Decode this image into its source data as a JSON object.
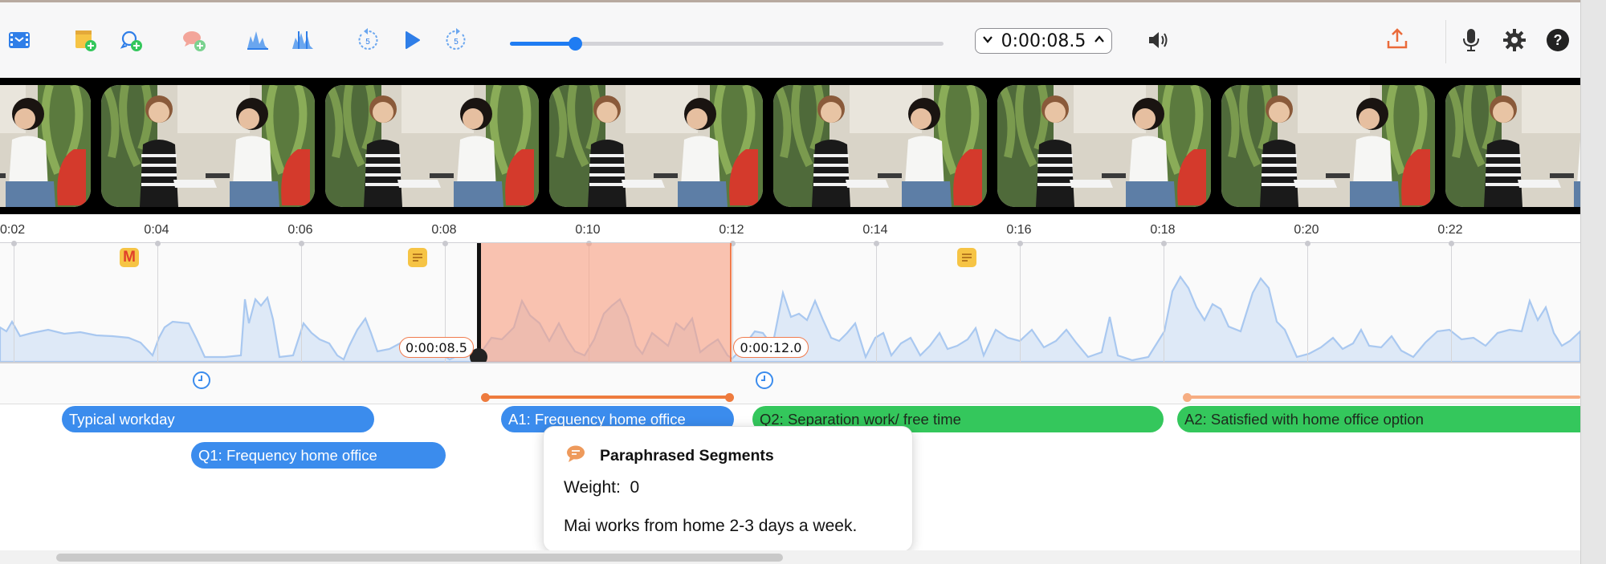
{
  "toolbar": {
    "icons": [
      "film-strip-icon",
      "add-document-icon",
      "add-memo-icon",
      "add-comment-icon",
      "waveform-icon",
      "waveform-edit-icon",
      "rewind-5-icon",
      "play-icon",
      "forward-5-icon",
      "volume-icon",
      "export-icon",
      "microphone-icon",
      "settings-icon",
      "help-icon"
    ],
    "accent_color": "#1f7cf2",
    "playback_position": 0.15,
    "time_value": "0:00:08.5"
  },
  "filmstrip": {
    "frame_count": 8
  },
  "ruler": {
    "ticks": [
      "0:02",
      "0:04",
      "0:06",
      "0:08",
      "0:10",
      "0:12",
      "0:14",
      "0:16",
      "0:18",
      "0:20",
      "0:22"
    ]
  },
  "markers": {
    "memo_letter": "M",
    "selection_start": "0:00:08.5",
    "selection_end": "0:00:12.0",
    "selection_color": "#f8a082"
  },
  "segments": [
    {
      "label": "Typical workday",
      "color": "#3b8ced"
    },
    {
      "label": "Q1: Frequency home office",
      "color": "#3b8ced"
    },
    {
      "label": "A1: Frequency home office",
      "color": "#3b8ced"
    },
    {
      "label": "Q2: Separation work/ free time",
      "color": "#34c75c"
    },
    {
      "label": "A2: Satisfied with home office option",
      "color": "#34c75c"
    }
  ],
  "popup": {
    "title": "Paraphrased Segments",
    "weight_label": "Weight:",
    "weight_value": "0",
    "text": "Mai works from home 2-3 days a week."
  }
}
